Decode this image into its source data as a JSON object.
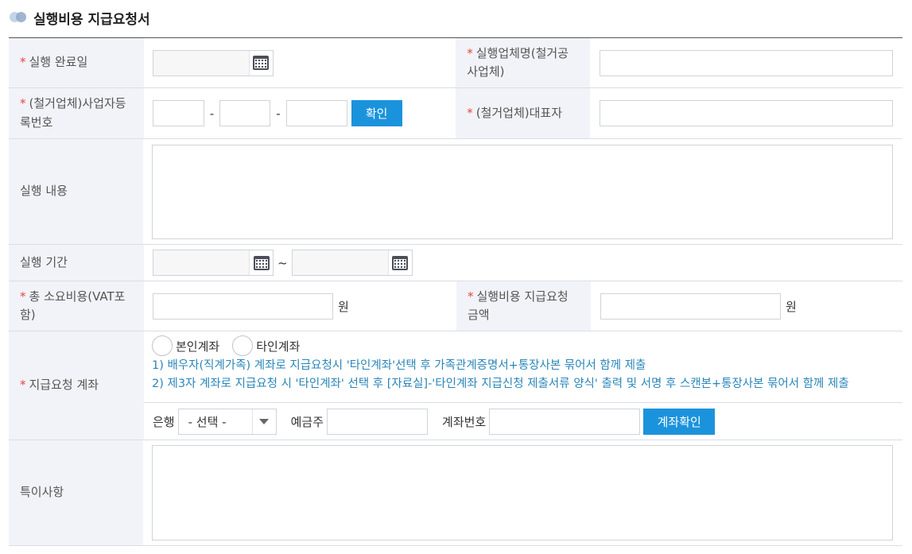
{
  "page_title": "실행비용 지급요청서",
  "fields": {
    "completion_date": {
      "label": "실행 완료일",
      "required": true,
      "value": ""
    },
    "contractor_name": {
      "label": "실행업체명(철거공사업체)",
      "label_line1": "실행업체명(철거공",
      "label_line2": "사업체)",
      "required": true,
      "value": ""
    },
    "business_number": {
      "label_line1": "(철거업체)사업자등",
      "label_line2": "록번호",
      "required": true,
      "dash": "-",
      "confirm_label": "확인",
      "parts": [
        "",
        "",
        ""
      ]
    },
    "representative": {
      "label": "(철거업체)대표자",
      "required": true,
      "value": ""
    },
    "content": {
      "label": "실행 내용",
      "value": ""
    },
    "period": {
      "label": "실행 기간",
      "separator": "~",
      "start": "",
      "end": ""
    },
    "total_cost": {
      "label_line1": "총 소요비용(VAT포",
      "label_line2": "함)",
      "required": true,
      "value": "",
      "unit": "원"
    },
    "request_amount": {
      "label_line1": "실행비용 지급요청",
      "label_line2": "금액",
      "required": true,
      "value": "",
      "unit": "원"
    },
    "account": {
      "label": "지급요청 계좌",
      "required": true,
      "radio_options": [
        "본인계좌",
        "타인계좌"
      ],
      "notes": [
        "1) 배우자(직계가족) 계좌로 지급요청시 '타인계좌'선택 후 가족관계증명서+통장사본 묶어서 함께 제출",
        "2) 제3자 계좌로 지급요청 시 '타인계좌' 선택 후 [자료실]-'타인계좌 지급신청 제출서류 양식' 출력 및 서명 후 스캔본+통장사본 묶어서 함께 제출"
      ],
      "bank_label": "은행",
      "bank_selected": "- 선택 -",
      "holder_label": "예금주",
      "account_no_label": "계좌번호",
      "verify_label": "계좌확인"
    },
    "remarks": {
      "label": "특이사항",
      "value": ""
    }
  },
  "required_mark": "*",
  "colors": {
    "accent": "#1b93dc",
    "required": "#e8453c",
    "note": "#2a86b8",
    "header_bg": "#f1f3f8"
  }
}
